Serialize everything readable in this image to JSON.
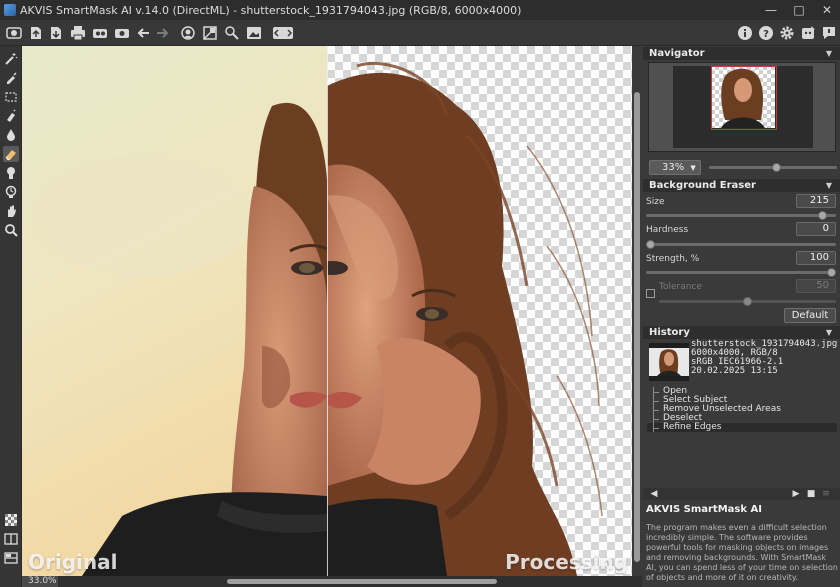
{
  "window": {
    "title": "AKVIS SmartMask AI v.14.0 (DirectML) - shutterstock_1931794043.jpg (RGB/8, 6000x4000)",
    "minimize_glyph": "—",
    "maximize_glyph": "□",
    "close_glyph": "✕"
  },
  "toolbar": {
    "left_icons": [
      "home-icon",
      "open-file-icon",
      "save-file-icon",
      "print-icon",
      "share-icon",
      "settings-preset-icon",
      "undo-arrow-icon",
      "redo-arrow-icon",
      "select-subject-icon",
      "remove-areas-icon",
      "refine-edges-icon",
      "fill-icon",
      "view-mode-icon"
    ],
    "right_icons": [
      "info-icon",
      "help-icon",
      "gear-icon",
      "ai-assistant-icon",
      "feedback-icon"
    ]
  },
  "left_tools": [
    "magic-brush-icon",
    "selection-brush-icon",
    "rectangle-select-icon",
    "eraser-brush-icon",
    "drop-icon",
    "background-eraser-icon",
    "clone-stamp-icon",
    "history-brush-icon",
    "hand-icon",
    "zoom-icon"
  ],
  "bottom_tools": [
    "checker-icon",
    "split-view-icon",
    "compare-icon"
  ],
  "canvas": {
    "left_caption": "Original",
    "right_caption": "Processing",
    "zoom_label": "33.0%"
  },
  "navigator": {
    "title": "Navigator",
    "zoom": "33%",
    "zoom_level": 0.53
  },
  "background_eraser": {
    "title": "Background Eraser",
    "size_label": "Size",
    "size_value": "215",
    "size_level": 0.95,
    "hardness_label": "Hardness",
    "hardness_value": "0",
    "hardness_level": 0.0,
    "strength_label": "Strength, %",
    "strength_value": "100",
    "strength_level": 1.0,
    "tolerance_label": "Tolerance",
    "tolerance_value": "50",
    "tolerance_level": 0.5,
    "default_button": "Default"
  },
  "history": {
    "title": "History",
    "file_name": "shutterstock_1931794043.jpg",
    "file_info": "6000x4000, RGB/8",
    "color_profile": "sRGB IEC61966-2.1",
    "date": "20.02.2025 13:15",
    "steps": [
      "Open",
      "Select Subject",
      "Remove Unselected Areas",
      "Deselect",
      "Refine Edges"
    ],
    "selected_step": "Refine Edges"
  },
  "about": {
    "title": "AKVIS SmartMask AI",
    "text": "The program makes even a difficult selection incredibly simple. The software provides powerful tools for masking objects on images and removing backgrounds. With SmartMask AI, you can spend less of your time on selection of objects and more of it on creativity."
  },
  "colors": {
    "accent_red": "#c23c3c",
    "panel_bg": "#3a3a3a",
    "header_bg": "#2e2e2e"
  }
}
